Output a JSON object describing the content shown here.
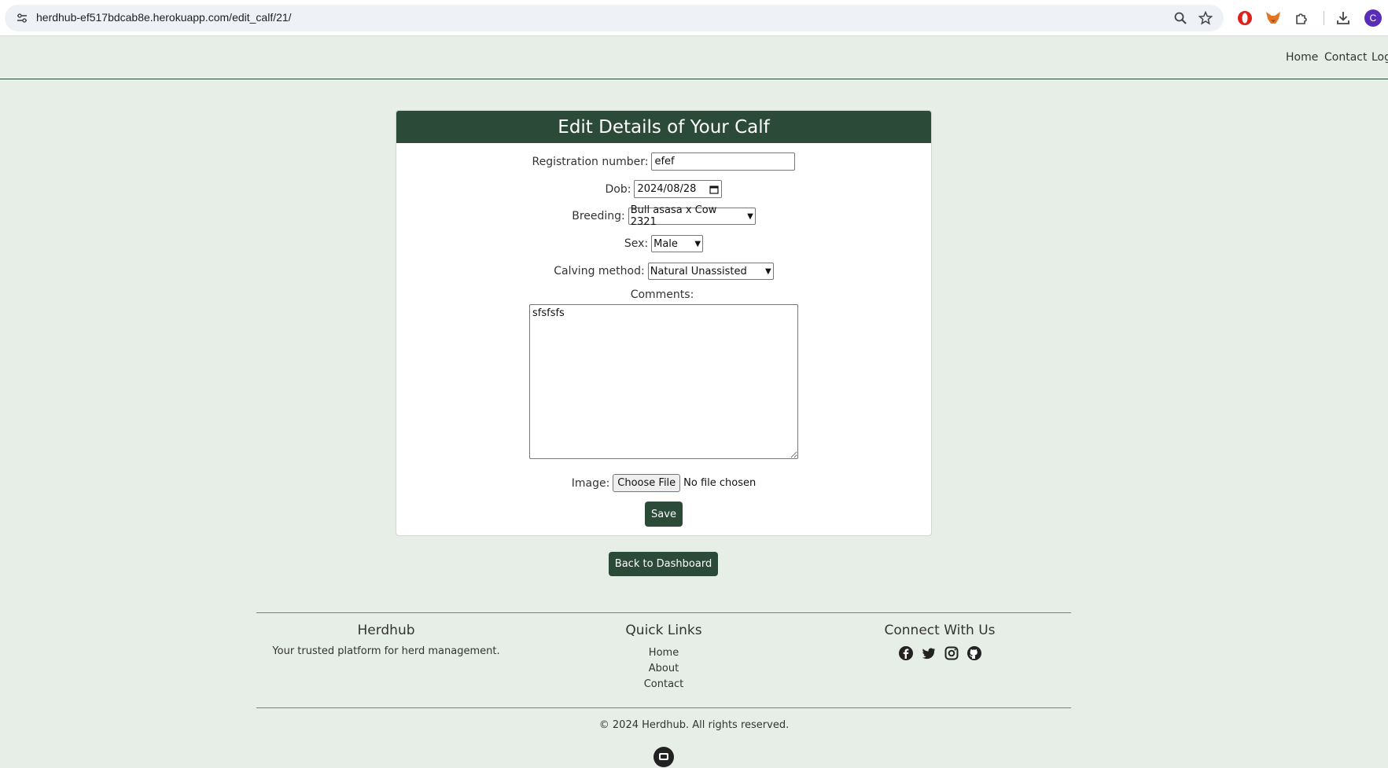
{
  "browser": {
    "url": "herdhub-ef517bdcab8e.herokuapp.com/edit_calf/21/",
    "profile_initial": "C",
    "colors": {
      "opera": "#e0201c",
      "fox": "#e27625",
      "profile": "#5a2db8"
    }
  },
  "nav": {
    "links": [
      "Home",
      "Contact",
      "Log"
    ]
  },
  "form": {
    "title": "Edit Details of Your Calf",
    "registration_label": "Registration number:",
    "registration_value": "efef",
    "dob_label": "Dob:",
    "dob_value": "2024/08/28",
    "breeding_label": "Breeding:",
    "breeding_value": "Bull asasa x Cow 2321",
    "sex_label": "Sex:",
    "sex_value": "Male",
    "calving_label": "Calving method:",
    "calving_value": "Natural Unassisted",
    "comments_label": "Comments:",
    "comments_value": "sfsfsfs",
    "image_label": "Image:",
    "choose_file": "Choose File",
    "no_file": "No file chosen",
    "save": "Save"
  },
  "back_button": "Back to Dashboard",
  "footer": {
    "brand": "Herdhub",
    "tagline": "Your trusted platform for herd management.",
    "quick_links_title": "Quick Links",
    "quick_links": [
      "Home",
      "About",
      "Contact"
    ],
    "connect_title": "Connect With Us",
    "social_icons": [
      "facebook-icon",
      "twitter-icon",
      "instagram-icon",
      "github-icon"
    ],
    "copyright": "© 2024 Herdhub. All rights reserved."
  },
  "colors": {
    "brand_green": "#2b4a37",
    "page_bg": "#e7eee7"
  }
}
